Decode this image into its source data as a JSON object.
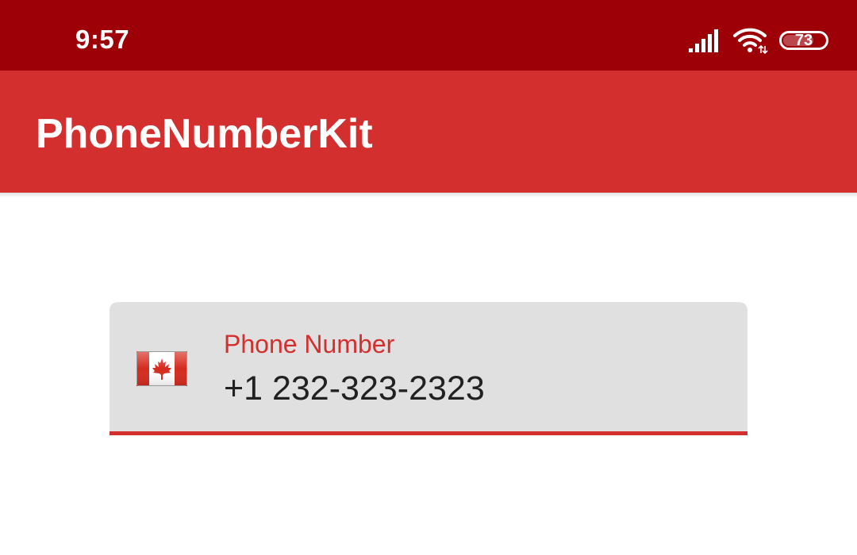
{
  "status_bar": {
    "time": "9:57",
    "signal_icon": "cellular-signal-icon",
    "wifi_icon": "wifi-icon",
    "battery_level": "73",
    "battery_fraction": 0.73
  },
  "app_bar": {
    "title": "PhoneNumberKit",
    "color": "#d32f2f"
  },
  "phone_field": {
    "label": "Phone Number",
    "value": "+1 232-323-2323",
    "country_flag_icon": "canada-flag-icon",
    "accent_color": "#d32f2f"
  },
  "colors": {
    "status_bar": "#9e0008",
    "app_bar": "#d32f2f",
    "field_background": "#e0e0e0",
    "text": "#212121"
  }
}
